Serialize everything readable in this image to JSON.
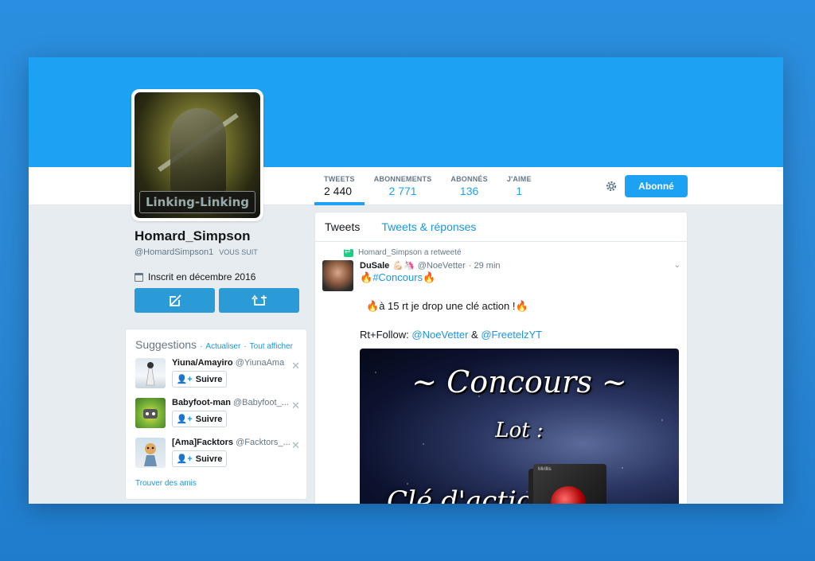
{
  "profile": {
    "name": "Homard_Simpson",
    "handle": "@HomardSimpson1",
    "follows_you": "VOUS SUIT",
    "joined": "Inscrit en décembre 2016",
    "avatar_caption": "Linking-Linking"
  },
  "stats": [
    {
      "label": "TWEETS",
      "value": "2 440"
    },
    {
      "label": "ABONNEMENTS",
      "value": "2 771"
    },
    {
      "label": "ABONNÉS",
      "value": "136"
    },
    {
      "label": "J'AIME",
      "value": "1"
    }
  ],
  "follow_button": "Abonné",
  "suggestions": {
    "title": "Suggestions",
    "refresh": "Actualiser",
    "show_all": "Tout afficher",
    "items": [
      {
        "name": "Yiuna/Amayiro",
        "handle": "@YiunaAma",
        "follow": "Suivre"
      },
      {
        "name": "Babyfoot-man",
        "handle": "@Babyfoot_...",
        "follow": "Suivre"
      },
      {
        "name": "[Ama]Facktors",
        "handle": "@Facktors_...",
        "follow": "Suivre"
      }
    ],
    "find_friends": "Trouver des amis"
  },
  "timeline": {
    "tabs": [
      "Tweets",
      "Tweets & réponses"
    ],
    "tweet": {
      "retweet_label": "Homard_Simpson a retweeté",
      "author_name": "DuSale",
      "author_emoji": "💪🏻🦄",
      "author_handle": "@NoeVetter",
      "time": "· 29 min",
      "line1_hashtag": "#Concours",
      "line2": "à 15 rt je drop une clé action !",
      "line3_prefix": "Rt+Follow: ",
      "mention1": "@NoeVetter",
      "amp": " & ",
      "mention2": "@FreetelzYT",
      "media_title": "~ Concours ~",
      "media_lot": "Lot :",
      "media_bottom": "Clé d'action",
      "media_brand": "Mirillis"
    }
  },
  "colors": {
    "accent": "#1da1f2",
    "action_button": "#2b9bd8",
    "retweet": "#19cf86"
  }
}
